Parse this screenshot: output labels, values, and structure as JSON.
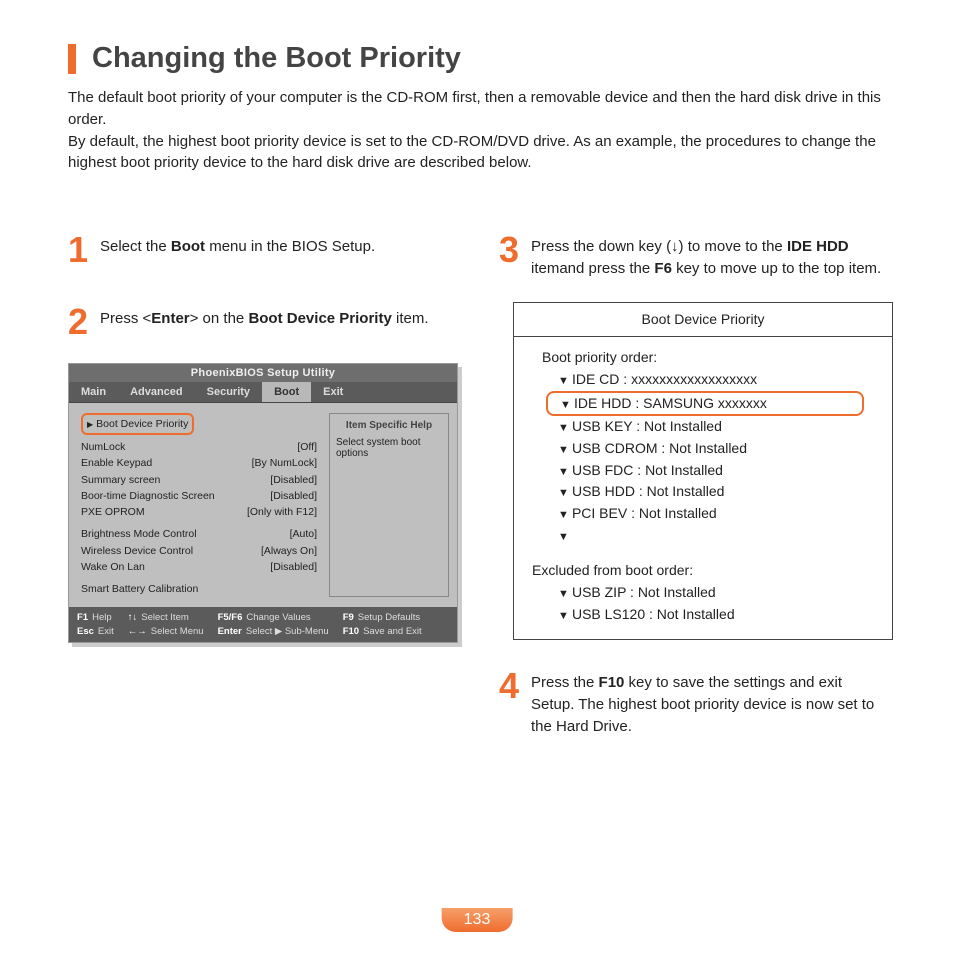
{
  "title": "Changing the Boot Priority",
  "intro": {
    "p1": "The default boot priority of your computer is the CD-ROM first, then a removable device and then the hard disk drive in this order.",
    "p2": "By default, the highest boot priority device is set to the CD-ROM/DVD drive. As an example, the procedures to change the highest boot priority device to the hard disk drive are described below."
  },
  "steps": {
    "s1": {
      "num": "1",
      "before": "Select the ",
      "bold": "Boot",
      "after": " menu in the BIOS Setup."
    },
    "s2": {
      "num": "2",
      "t1": "Press <",
      "b1": "Enter",
      "t2": "> on the ",
      "b2": "Boot Device Priority",
      "t3": " item."
    },
    "s3": {
      "num": "3",
      "t1": "Press the down key (↓) to move to the ",
      "b1": "IDE HDD",
      "t2": " itemand press the ",
      "b2": "F6",
      "t3": " key to move up to the top item."
    },
    "s4": {
      "num": "4",
      "t1": "Press the ",
      "b1": "F10",
      "t2": " key to save the settings and exit Setup. The highest boot priority device is now set to the Hard Drive."
    }
  },
  "bios": {
    "window_title": "PhoenixBIOS Setup Utility",
    "tabs": {
      "main": "Main",
      "advanced": "Advanced",
      "security": "Security",
      "boot": "Boot",
      "exit": "Exit"
    },
    "highlight_item": "Boot Device Priority",
    "rows": [
      {
        "label": "NumLock",
        "value": "[Off]"
      },
      {
        "label": "Enable Keypad",
        "value": "[By NumLock]"
      },
      {
        "label": "Summary screen",
        "value": "[Disabled]"
      },
      {
        "label": "Boor-time Diagnostic Screen",
        "value": "[Disabled]"
      },
      {
        "label": "PXE OPROM",
        "value": "[Only with F12]"
      }
    ],
    "rows2": [
      {
        "label": "Brightness Mode Control",
        "value": "[Auto]"
      },
      {
        "label": "Wireless Device Control",
        "value": "[Always On]"
      },
      {
        "label": "Wake On Lan",
        "value": "[Disabled]"
      }
    ],
    "rows3": [
      {
        "label": "Smart Battery Calibration",
        "value": ""
      }
    ],
    "help_title": "Item Specific Help",
    "help_text": "Select system boot options",
    "footer": {
      "c1a": "F1",
      "c1at": "Help",
      "c1b": "Esc",
      "c1bt": "Exit",
      "c2a": "↑↓",
      "c2at": "Select Item",
      "c2b": "←→",
      "c2bt": "Select Menu",
      "c3a": "F5/F6",
      "c3at": "Change Values",
      "c3b": "Enter",
      "c3bt": "Select ▶ Sub-Menu",
      "c4a": "F9",
      "c4at": "Setup Defaults",
      "c4b": "F10",
      "c4bt": "Save and Exit"
    }
  },
  "bootbox": {
    "title": "Boot Device Priority",
    "order_label": "Boot priority order:",
    "items": {
      "i0": "IDE CD : xxxxxxxxxxxxxxxxxx",
      "i1": "IDE HDD : SAMSUNG xxxxxxx",
      "i2": "USB KEY : Not Installed",
      "i3": "USB CDROM : Not Installed",
      "i4": "USB FDC : Not Installed",
      "i5": "USB HDD : Not Installed",
      "i6": "PCI BEV : Not Installed"
    },
    "excluded_label": "Excluded from boot order:",
    "excluded": {
      "e0": "USB ZIP : Not Installed",
      "e1": "USB LS120 : Not Installed"
    }
  },
  "page_number": "133"
}
